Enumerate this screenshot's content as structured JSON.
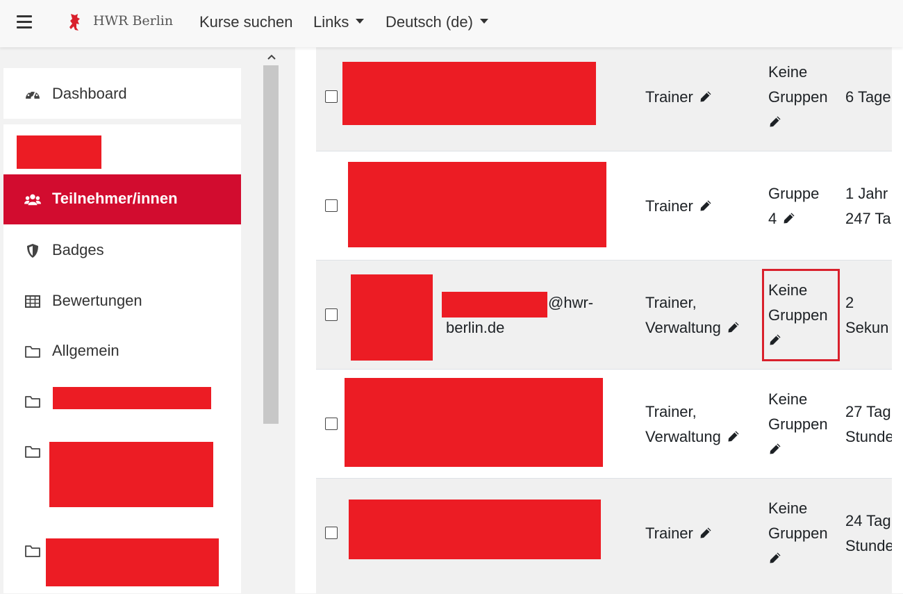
{
  "navbar": {
    "brand": "HWR Berlin",
    "links": [
      {
        "label": "Kurse suchen"
      },
      {
        "label": "Links"
      },
      {
        "label": "Deutsch (de)"
      }
    ]
  },
  "drawer": {
    "items": [
      {
        "label": "Dashboard",
        "icon": "dashboard-icon"
      },
      {
        "label": "Teilnehmer/innen",
        "icon": "users-icon",
        "active": true
      },
      {
        "label": "Badges",
        "icon": "shield-icon"
      },
      {
        "label": "Bewertungen",
        "icon": "table-icon"
      },
      {
        "label": "Allgemein",
        "icon": "folder-icon"
      }
    ]
  },
  "table": {
    "rows": [
      {
        "roles": [
          "Trainer"
        ],
        "groups": [
          "Keine",
          "Gruppen"
        ],
        "last_access": [
          "6 Tage"
        ]
      },
      {
        "roles": [
          "Trainer"
        ],
        "groups": [
          "Gruppe",
          "4"
        ],
        "last_access": [
          "1 Jahr",
          "247 Ta"
        ]
      },
      {
        "email_suffix": "@hwr-",
        "email_line2": "berlin.de",
        "roles": [
          "Trainer,",
          "Verwaltung"
        ],
        "groups": [
          "Keine",
          "Gruppen"
        ],
        "last_access": [
          "2",
          "Sekun"
        ]
      },
      {
        "roles": [
          "Trainer,",
          "Verwaltung"
        ],
        "groups": [
          "Keine",
          "Gruppen"
        ],
        "last_access": [
          "27 Tag",
          "Stunde"
        ]
      },
      {
        "roles": [
          "Trainer"
        ],
        "groups": [
          "Keine",
          "Gruppen"
        ],
        "last_access": [
          "24 Tag",
          "Stunde"
        ]
      }
    ]
  },
  "colors": {
    "accent": "#d20c2f",
    "redaction": "#ec1c24",
    "highlight": "#d9202c"
  }
}
